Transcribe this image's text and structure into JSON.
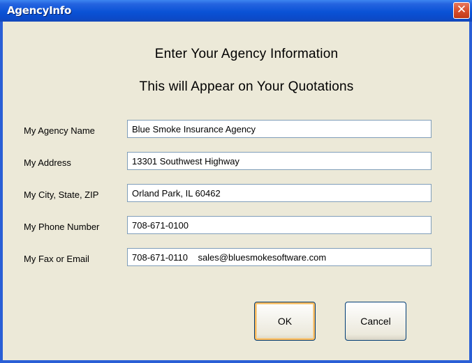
{
  "window": {
    "title": "AgencyInfo",
    "close_symbol": "✕"
  },
  "heading": {
    "line1": "Enter Your Agency Information",
    "line2": "This will Appear on Your Quotations"
  },
  "fields": [
    {
      "label": "My Agency Name",
      "value": "Blue Smoke Insurance Agency"
    },
    {
      "label": "My Address",
      "value": "13301 Southwest Highway"
    },
    {
      "label": "My City, State,  ZIP",
      "value": "Orland Park, IL 60462"
    },
    {
      "label": "My Phone Number",
      "value": "708-671-0100"
    },
    {
      "label": "My Fax or Email",
      "value": "708-671-0110    sales@bluesmokesoftware.com"
    }
  ],
  "buttons": {
    "ok_label": "OK",
    "cancel_label": "Cancel"
  },
  "colors": {
    "titlebar": "#0a52d6",
    "dialog_background": "#ece9d8",
    "close_button": "#d8502e",
    "default_button_highlight": "#f8b85c"
  }
}
